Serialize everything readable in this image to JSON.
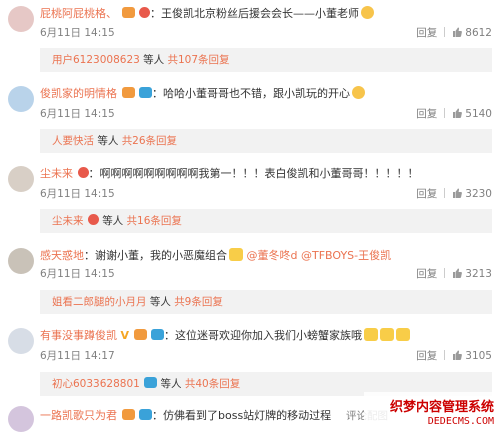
{
  "comments": [
    {
      "username": "屁桃阿屁桃格、",
      "text": "王俊凯北京粉丝后援会会长——小董老师",
      "date": "6月11日 14:15",
      "reply_label": "回复",
      "likes": "8612",
      "sub_user": "用户6123008623",
      "sub_text": "等人",
      "sub_count": "共107条回复"
    },
    {
      "username": "俊凯家的明情格",
      "text": "哈哈小董哥哥也不错，跟小凯玩的开心",
      "date": "6月11日 14:15",
      "reply_label": "回复",
      "likes": "5140",
      "sub_user": "人要快活",
      "sub_text": "等人",
      "sub_count": "共26条回复"
    },
    {
      "username": "尘未来",
      "text": "啊啊啊啊啊啊啊啊啊我第一！！！表白俊凯和小董哥哥！！！！！",
      "date": "6月11日 14:15",
      "reply_label": "回复",
      "likes": "3230",
      "sub_user": "尘未来",
      "sub_text": "等人",
      "sub_count": "共16条回复"
    },
    {
      "username": "感天惑地",
      "text": "谢谢小董，我的小恶魔组合",
      "mention1": "@董冬咚d",
      "mention2": "@TFBOYS-王俊凯",
      "date": "6月11日 14:15",
      "reply_label": "回复",
      "likes": "3213",
      "sub_user": "姐看二郎腿的小月月",
      "sub_text": "等人",
      "sub_count": "共9条回复"
    },
    {
      "username": "有事没事蹲俊凯",
      "text": "这位迷哥欢迎你加入我们小螃蟹家族哦",
      "date": "6月11日 14:17",
      "reply_label": "回复",
      "likes": "3105",
      "sub_user": "初心6033628801",
      "sub_text": "等人",
      "sub_count": "共40条回复"
    },
    {
      "username": "一路凯歌只为君",
      "text": "仿佛看到了boss站灯牌的移动过程",
      "date": "",
      "reply_label": "评论配图"
    }
  ],
  "watermark": {
    "title": "织梦内容管理系统",
    "url": "DEDECMS.COM"
  },
  "colors": {
    "accent": "#eb7350",
    "meta": "#808080",
    "sub_bg": "#f2f2f2"
  }
}
